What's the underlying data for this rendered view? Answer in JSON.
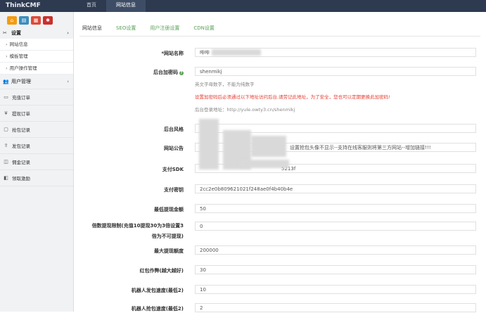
{
  "topbar": {
    "brand": "ThinkCMF",
    "nav": [
      "首页",
      "网站信息"
    ]
  },
  "sidebar": {
    "shortcut_icons": [
      "home-icon",
      "file-icon",
      "trash-icon",
      "gear-icon"
    ],
    "groups": [
      {
        "label": "设置",
        "icon": "wrench-icon",
        "subitems": [
          "网站信息",
          "模板管理",
          "用户操作管理"
        ]
      },
      {
        "label": "用户管理",
        "icon": "users-icon",
        "subitems": []
      }
    ],
    "items": [
      {
        "label": "充值订单",
        "icon": "cart-icon"
      },
      {
        "label": "提现订单",
        "icon": "yen-icon"
      },
      {
        "label": "抢包记录",
        "icon": "grab-icon"
      },
      {
        "label": "发包记录",
        "icon": "send-icon"
      },
      {
        "label": "佣金记录",
        "icon": "coin-icon"
      },
      {
        "label": "领取激励",
        "icon": "gift-icon"
      }
    ]
  },
  "main": {
    "tabs": [
      "网站信息",
      "SEO设置",
      "用户注册设置",
      "CDN设置"
    ],
    "form": {
      "site_name_label": "*网站名称",
      "site_name_value": "哔哔",
      "admin_code_label": "后台加密码",
      "admin_code_value": "shenmikj",
      "admin_code_hint1": "英文字母数字，不能为纯数字",
      "admin_code_hint2": "设置加密码后必须通过以下地址访问后台,请劳记此地址，为了安全，您也可以定期更换此加密码!",
      "admin_code_hint3": "后台登录地址：http://yule.owty3.cn/shenmikj",
      "admin_style_label": "后台风格",
      "notice_label": "网站公告",
      "notice_value": "设置抢包头像不显示--支持在线客服则将第三方网站--增加链接!!!",
      "pay_sdk_label": "支付SDK",
      "pay_sdk_value": "5213f",
      "pay_key_label": "支付密钥",
      "pay_key_value": "2cc2e0b809621021f248ae0f4b40b4e",
      "min_withdraw_label": "最低提现金额",
      "min_withdraw_value": "50",
      "multiple_label_line1": "倍数提现限制(充值10提现30为3倍设置3",
      "multiple_label_line2": "倍为不可提现)",
      "multiple_value": "0",
      "max_withdraw_label": "最大提现额度",
      "max_withdraw_value": "200000",
      "redpack_label": "红包作弊(越大越好)",
      "redpack_value": "30",
      "robot_send_label": "机器人发包速度(最低2)",
      "robot_send_value": "10",
      "robot_grab_label": "机器人抢包速度(最低2)",
      "robot_grab_value": "2"
    }
  }
}
